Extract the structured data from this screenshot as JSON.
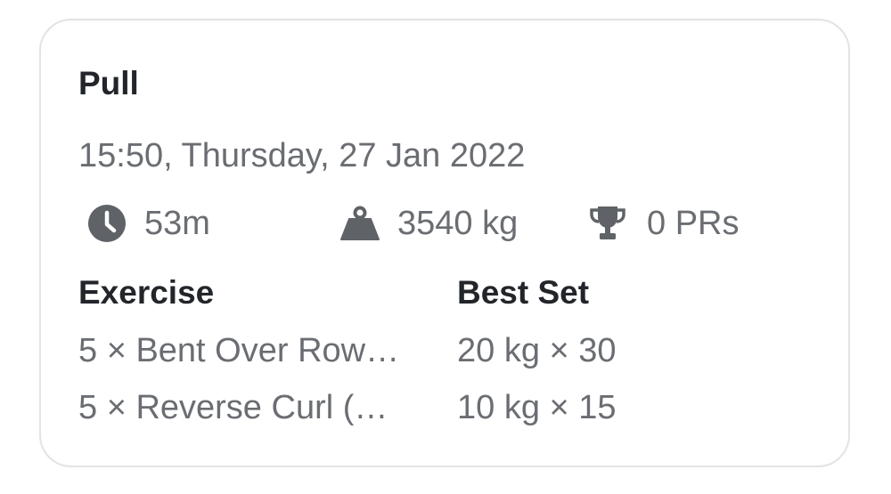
{
  "workout": {
    "title": "Pull",
    "datetime": "15:50, Thursday, 27 Jan 2022",
    "stats": {
      "duration": "53m",
      "volume": "3540 kg",
      "prs": "0 PRs"
    },
    "table": {
      "headers": {
        "exercise": "Exercise",
        "best_set": "Best Set"
      },
      "rows": [
        {
          "exercise": "5 × Bent Over Row…",
          "best_set": "20 kg × 30"
        },
        {
          "exercise": "5 × Reverse Curl (…",
          "best_set": "10 kg × 15"
        }
      ]
    }
  },
  "icons": {
    "duration": "clock-icon",
    "volume": "weight-icon",
    "prs": "trophy-icon"
  },
  "colors": {
    "title": "#22262b",
    "secondary_text": "#6a6d72",
    "icon": "#5f6267",
    "card_border": "#e3e3e3"
  }
}
